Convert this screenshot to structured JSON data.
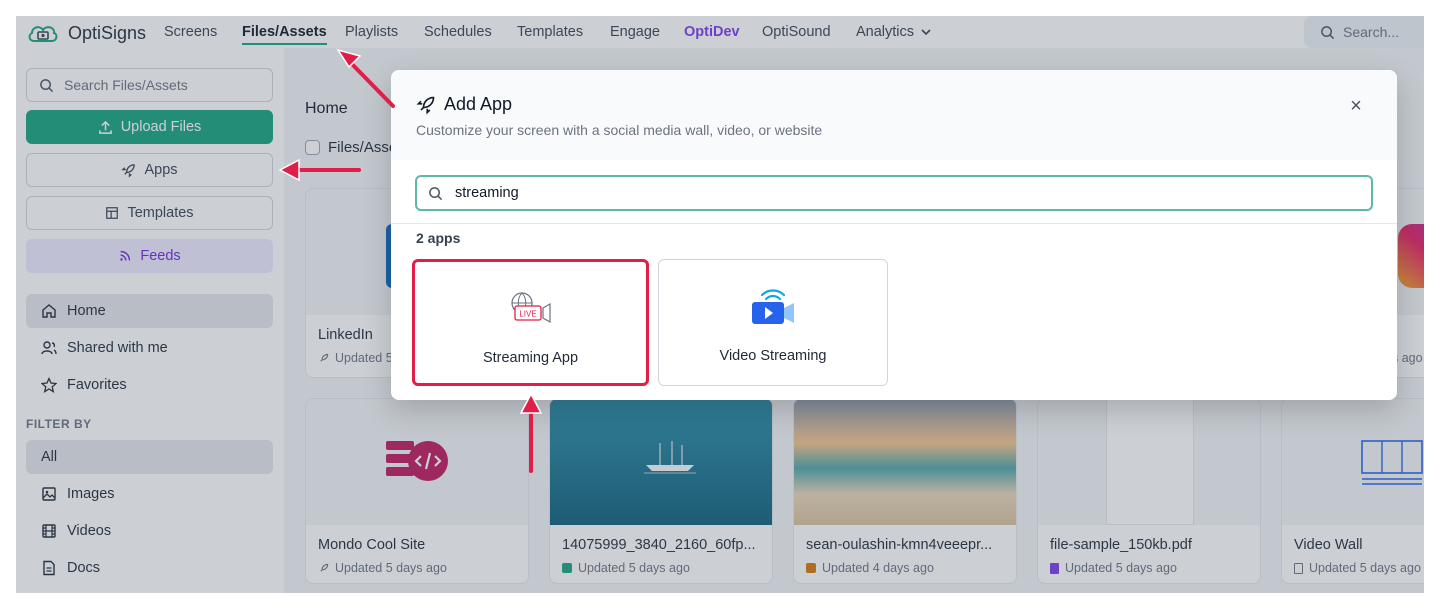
{
  "app": {
    "brand": "OptiSigns"
  },
  "nav": {
    "items": [
      "Screens",
      "Files/Assets",
      "Playlists",
      "Schedules",
      "Templates",
      "Engage",
      "OptiDev",
      "OptiSound",
      "Analytics"
    ],
    "active": "Files/Assets",
    "search_placeholder": "Search..."
  },
  "sidebar": {
    "search_placeholder": "Search Files/Assets",
    "upload_label": "Upload Files",
    "apps_label": "Apps",
    "templates_label": "Templates",
    "feeds_label": "Feeds",
    "links": [
      "Home",
      "Shared with me",
      "Favorites"
    ],
    "filter_title": "FILTER BY",
    "filters": [
      "All",
      "Images",
      "Videos",
      "Docs"
    ]
  },
  "main": {
    "header": "Home",
    "files_label": "Files/Assets",
    "cards": [
      {
        "title": "LinkedIn",
        "meta": "Updated 5 days ago",
        "icon": "rocket-icon"
      },
      {
        "title": "Mondo Cool Site",
        "meta": "Updated 5 days ago",
        "icon": "rocket-icon"
      },
      {
        "title": "14075999_3840_2160_60fp...",
        "meta": "Updated 5 days ago",
        "icon": "video-icon"
      },
      {
        "title": "sean-oulashin-kmn4veeepr...",
        "meta": "Updated 4 days ago",
        "icon": "image-icon"
      },
      {
        "title": "file-sample_150kb.pdf",
        "meta": "Updated 5 days ago",
        "icon": "doc-icon"
      },
      {
        "title": "Video Wall",
        "meta": "Updated 5 days ago",
        "icon": "file-icon"
      }
    ],
    "partial_right_meta": "s ago"
  },
  "modal": {
    "title": "Add App",
    "subtitle": "Customize your screen with a social media wall, video, or website",
    "close_glyph": "×",
    "search_value": "streaming",
    "count_label": "2 apps",
    "apps": [
      {
        "name": "Streaming App",
        "icon": "live-stream-icon"
      },
      {
        "name": "Video Streaming",
        "icon": "video-streaming-icon"
      }
    ],
    "live_badge": "LIVE"
  },
  "colors": {
    "accent": "#16a37f",
    "optidev": "#7c3aed",
    "annotation": "#e11d48"
  }
}
